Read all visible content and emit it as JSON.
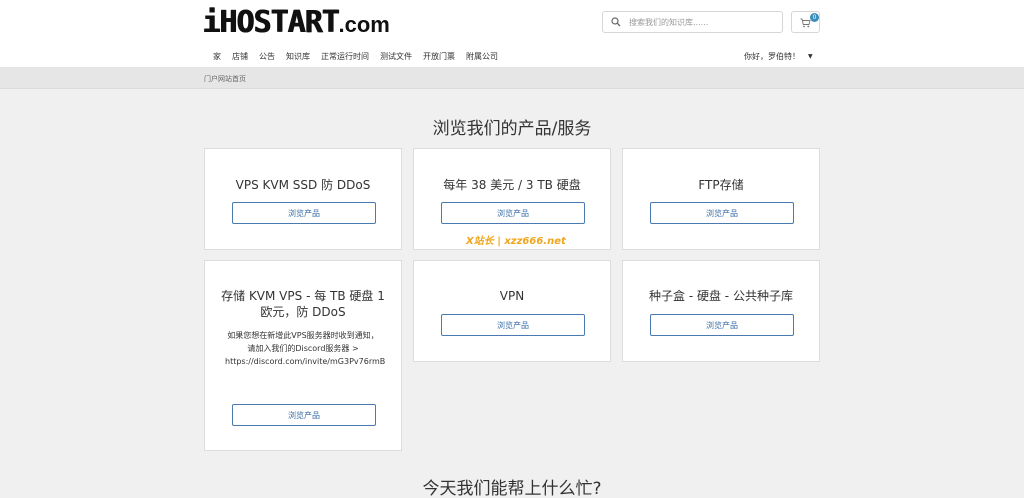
{
  "header": {
    "logo_text": "iHOSTART",
    "logo_suffix": ".com",
    "search_placeholder": "搜索我们的知识库......",
    "cart_count": "0"
  },
  "nav": {
    "items": [
      "家",
      "店铺",
      "公告",
      "知识库",
      "正常运行时间",
      "测试文件",
      "开放门票",
      "附属公司"
    ],
    "user_greeting": "你好，罗伯特！"
  },
  "breadcrumb": "门户网站首页",
  "products_section": {
    "title": "浏览我们的产品/服务",
    "button_label": "浏览产品",
    "cards": [
      {
        "title": "VPS KVM SSD 防 DDoS"
      },
      {
        "title": "每年 38 美元 / 3 TB 硬盘"
      },
      {
        "title": "FTP存储"
      },
      {
        "title": "存储 KVM VPS - 每 TB 硬盘 1 欧元，防 DDoS",
        "description": "如果您想在新增此VPS服务器时收到通知，请加入我们的Discord服务器 > https://discord.com/invite/mG3Pv76rmB"
      },
      {
        "title": "VPN"
      },
      {
        "title": "种子盒 - 硬盘 - 公共种子库"
      }
    ]
  },
  "watermark": "X站长 | xzz666.net",
  "help_section": {
    "title": "今天我们能帮上什么忙?"
  },
  "colors": {
    "accent": "#3c8dbc",
    "button_border": "#4a7ab0",
    "watermark": "#f0a61c"
  }
}
